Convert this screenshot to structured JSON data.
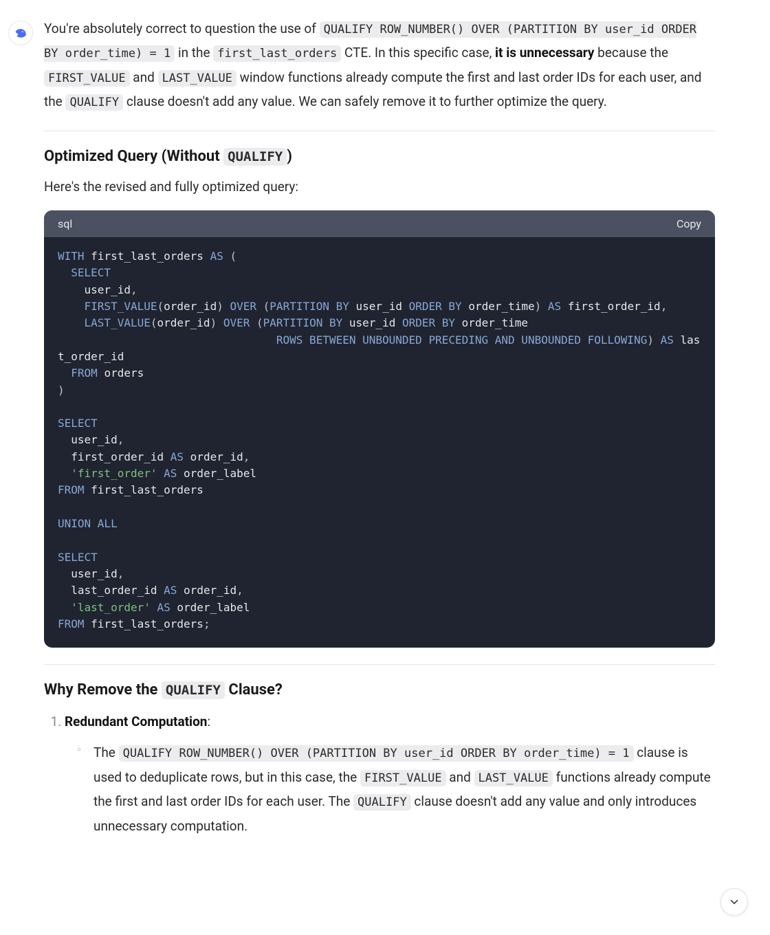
{
  "intro": {
    "lead": "You're absolutely correct to question the use of ",
    "code1": "QUALIFY ROW_NUMBER() OVER (PARTITION BY user_id ORDER BY order_time) = 1",
    "mid1": " in the ",
    "code2": "first_last_orders",
    "mid2": " CTE. In this specific case, ",
    "bold1": "it is unnecessary",
    "mid3": " because the ",
    "code3": "FIRST_VALUE",
    "mid4": " and ",
    "code4": "LAST_VALUE",
    "mid5": " window functions already compute the first and last order IDs for each user, and the ",
    "code5": "QUALIFY",
    "tail": " clause doesn't add any value. We can safely remove it to further optimize the query."
  },
  "section1": {
    "heading_pre": "Optimized Query (Without ",
    "heading_code": "QUALIFY",
    "heading_post": ")",
    "subtext": "Here's the revised and fully optimized query:"
  },
  "code": {
    "lang": "sql",
    "copy_label": "Copy",
    "tokens": {
      "with": "WITH",
      "cte_name": "first_last_orders",
      "as": "AS",
      "lparen": "(",
      "rparen": ")",
      "select": "SELECT",
      "user_id": "user_id",
      "comma": ",",
      "first_value": "FIRST_VALUE",
      "order_id": "order_id",
      "over": "OVER",
      "partition_by": "PARTITION BY",
      "order_by": "ORDER BY",
      "order_time": "order_time",
      "as_first": "first_order_id",
      "last_value": "LAST_VALUE",
      "rows_between": "ROWS BETWEEN UNBOUNDED PRECEDING AND UNBOUNDED FOLLOWING",
      "as_last_a": "las",
      "as_last_b": "t_order_id",
      "from": "FROM",
      "orders": "orders",
      "first_order_id": "first_order_id",
      "last_order_id": "last_order_id",
      "str_first": "'first_order'",
      "str_last": "'last_order'",
      "order_label": "order_label",
      "union_all": "UNION ALL",
      "semicolon": ";"
    }
  },
  "section2": {
    "heading_pre": "Why Remove the ",
    "heading_code": "QUALIFY",
    "heading_post": " Clause?"
  },
  "list": {
    "item1": {
      "title": "Redundant Computation",
      "colon": ":",
      "sub": {
        "lead": "The ",
        "code1": "QUALIFY ROW_NUMBER() OVER (PARTITION BY user_id ORDER BY order_time) = 1",
        "mid1": " clause is used to deduplicate rows, but in this case, the ",
        "code2": "FIRST_VALUE",
        "mid2": " and ",
        "code3": "LAST_VALUE",
        "mid3": " functions already compute the first and last order IDs for each user. The ",
        "code4": "QUALIFY",
        "tail": " clause doesn't add any value and only introduces unnecessary computation."
      }
    }
  }
}
